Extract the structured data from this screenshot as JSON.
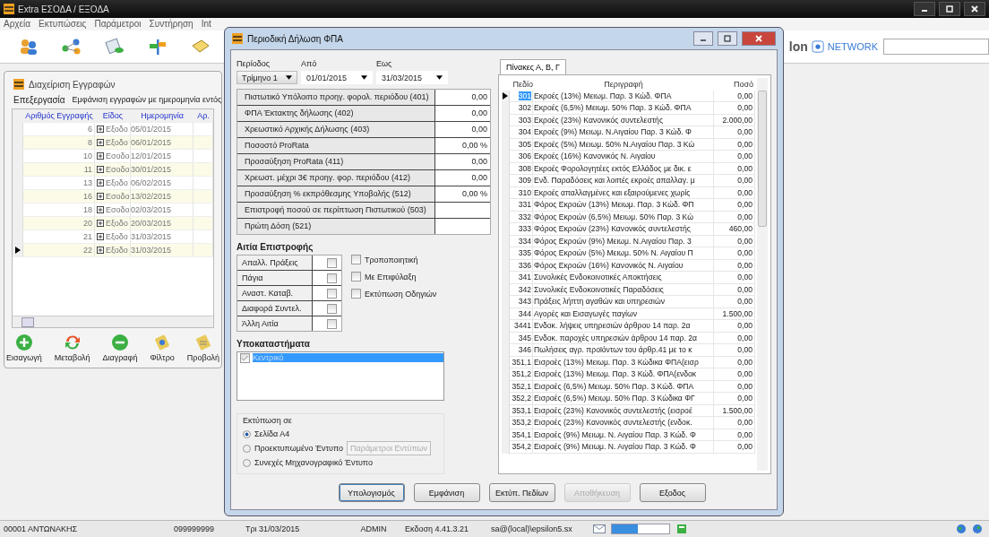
{
  "app": {
    "title": "Extra ΕΣΟΔΑ / ΕΞΟΔΑ",
    "menu": [
      "Αρχεία",
      "Εκτυπώσεις",
      "Παράμετροι",
      "Συντήρηση",
      "Int"
    ],
    "brand": {
      "partial": "lon",
      "network": "NETWORK"
    }
  },
  "documents_panel": {
    "title": "Διαχείριση Εγγραφών",
    "menu": [
      "Επεξεργασία",
      "Εμφάνιση εγγραφών με ημερομηνία εντός"
    ],
    "columns": [
      "Αριθμός Εγγραφής",
      "Είδος",
      "Ημερομηνία",
      "Αρ."
    ],
    "rows": [
      {
        "number": "6",
        "kind": "Εξοδο",
        "date": "05/01/2015",
        "selected": false
      },
      {
        "number": "8",
        "kind": "Εξοδο",
        "date": "06/01/2015",
        "selected": false
      },
      {
        "number": "10",
        "kind": "Εσοδο",
        "date": "12/01/2015",
        "selected": false
      },
      {
        "number": "11",
        "kind": "Εσοδο",
        "date": "30/01/2015",
        "selected": false
      },
      {
        "number": "13",
        "kind": "Εξοδο",
        "date": "06/02/2015",
        "selected": false
      },
      {
        "number": "16",
        "kind": "Εσοδο",
        "date": "13/02/2015",
        "selected": false
      },
      {
        "number": "18",
        "kind": "Εσοδο",
        "date": "02/03/2015",
        "selected": false
      },
      {
        "number": "20",
        "kind": "Εξοδο",
        "date": "20/03/2015",
        "selected": false
      },
      {
        "number": "21",
        "kind": "Εξοδο",
        "date": "31/03/2015",
        "selected": false
      },
      {
        "number": "22",
        "kind": "Εξοδο",
        "date": "31/03/2015",
        "selected": true
      }
    ],
    "actions": [
      {
        "label": "Εισαγωγή",
        "kind": "add"
      },
      {
        "label": "Μεταβολή",
        "kind": "modify"
      },
      {
        "label": "Διαγραφή",
        "kind": "delete"
      },
      {
        "label": "Φίλτρο",
        "kind": "filter"
      },
      {
        "label": "Προβολή",
        "kind": "view"
      }
    ]
  },
  "dialog": {
    "title": "Περιοδική Δήλωση ΦΠΑ",
    "period": {
      "label": "Περίοδος",
      "value": "Τρίμηνο 1"
    },
    "from": {
      "label": "Από",
      "value": "01/01/2015"
    },
    "to": {
      "label": "Εως",
      "value": "31/03/2015"
    },
    "fields": [
      {
        "label": "Πιστωτικό Υπόλοιπο προηγ. φορολ. περιόδου (401)",
        "value": "0,00"
      },
      {
        "label": "ΦΠΑ Έκτακτης δήλωσης (402)",
        "value": "0,00"
      },
      {
        "label": "Χρεωστικό Αρχικής Δήλωσης (403)",
        "value": "0,00"
      },
      {
        "label": "Ποσοστό ProRata",
        "value": "0,00 %"
      },
      {
        "label": "Προσαύξηση ProRata (411)",
        "value": "0,00"
      },
      {
        "label": "Χρεωστ. μέχρι 3€ προηγ. φορ. περιόδου (412)",
        "value": "0,00"
      },
      {
        "label": "Προσαύξηση % εκπρόθεσμης Υποβολής (512)",
        "value": "0,00 %"
      },
      {
        "label": "Επιστροφή ποσού σε περίπτωση Πιστωτικού (503)"
      },
      {
        "label": "Πρώτη Δόση (521)"
      }
    ],
    "refund_reason": {
      "title": "Αιτία Επιστροφής",
      "items": [
        {
          "label": "Απαλλ. Πράξεις",
          "checked": false
        },
        {
          "label": "Πάγια",
          "checked": false
        },
        {
          "label": "Αναστ. Καταβ.",
          "checked": false
        },
        {
          "label": "Διαφορά Συντελ.",
          "checked": false
        },
        {
          "label": "Άλλη Αιτία",
          "checked": false
        }
      ]
    },
    "options": [
      {
        "label": "Τροποποιητική",
        "checked": false
      },
      {
        "label": "Με Επιφύλαξη",
        "checked": false
      },
      {
        "label": "Εκτύπωση Οδηγιών",
        "checked": false
      }
    ],
    "branches": {
      "title": "Υποκαταστήματα",
      "items": [
        {
          "label": "Κεντρικό",
          "checked": true,
          "selected": true
        }
      ]
    },
    "print": {
      "title": "Εκτύπωση σε",
      "options": [
        {
          "label": "Σελίδα Α4",
          "selected": true
        },
        {
          "label": "Προεκτυπωμένο Έντυπο",
          "selected": false
        },
        {
          "label": "Συνεχές Μηχανογραφικό Έντυπο",
          "selected": false
        }
      ],
      "params_button": "Παράμετροι Εντύπων"
    },
    "tab": "Πίνακες Α, Β, Γ",
    "table": {
      "columns": [
        "Πεδίο",
        "Περιγραφή",
        "Ποσό"
      ],
      "rows": [
        {
          "field": "301",
          "description": "Εκροές (13%)  Μειωμ. Παρ. 3 Κώδ. ΦΠΑ",
          "amount": "0,00",
          "selected": true
        },
        {
          "field": "302",
          "description": "Εκροές (6,5%) Μειωμ. 50% Παρ. 3 Κώδ. ΦΠΑ",
          "amount": "0,00",
          "selected": false
        },
        {
          "field": "303",
          "description": "Εκροές (23%) Κανονικός συντελεστής",
          "amount": "2.000,00",
          "selected": false
        },
        {
          "field": "304",
          "description": "Εκροές (9%)  Μειωμ. Ν.Αιγαίου Παρ. 3 Κώδ. Φ",
          "amount": "0,00",
          "selected": false
        },
        {
          "field": "305",
          "description": "Εκροές (5%) Μειωμ. 50% Ν.Αιγαίου Παρ. 3 Κώ",
          "amount": "0,00",
          "selected": false
        },
        {
          "field": "306",
          "description": "Εκροές (16%) Κανονικός Ν. Αιγαίου",
          "amount": "0,00",
          "selected": false
        },
        {
          "field": "308",
          "description": "Εκροές Φορολογητέες εκτός Ελλάδος με δικ. ε",
          "amount": "0,00",
          "selected": false
        },
        {
          "field": "309",
          "description": "Ενδ. Παραδόσεις και λοιπές εκροές απαλλαγ. μ",
          "amount": "0,00",
          "selected": false
        },
        {
          "field": "310",
          "description": "Εκροές απαλλαγμένες και εξαιρούμενες χωρίς",
          "amount": "0,00",
          "selected": false
        },
        {
          "field": "331",
          "description": "Φόρος Εκροών (13%)  Μειωμ. Παρ. 3 Κώδ. ΦΠ",
          "amount": "0,00",
          "selected": false
        },
        {
          "field": "332",
          "description": "Φόρος Εκροών (6,5%) Μειωμ. 50% Παρ. 3 Κώ",
          "amount": "0,00",
          "selected": false
        },
        {
          "field": "333",
          "description": "Φόρος Εκροών (23%) Κανονικός συντελεστής",
          "amount": "460,00",
          "selected": false
        },
        {
          "field": "334",
          "description": "Φόρος Εκροών (9%)  Μειωμ. Ν.Αιγαίου Παρ. 3",
          "amount": "0,00",
          "selected": false
        },
        {
          "field": "335",
          "description": "Φόρος Εκροών (5%) Μειωμ. 50% Ν. Αιγαίου Π",
          "amount": "0,00",
          "selected": false
        },
        {
          "field": "336",
          "description": "Φόρος Εκροών (16%) Κανονικός Ν. Αιγαίου",
          "amount": "0,00",
          "selected": false
        },
        {
          "field": "341",
          "description": "Συνολικές Ενδοκοινοτικές Αποκτήσεις",
          "amount": "0,00",
          "selected": false
        },
        {
          "field": "342",
          "description": "Συνολικές Ενδοκοινοτικές Παραδόσεις",
          "amount": "0,00",
          "selected": false
        },
        {
          "field": "343",
          "description": "Πράξεις λήπτη αγαθών και υπηρεσιών",
          "amount": "0,00",
          "selected": false
        },
        {
          "field": "344",
          "description": "Αγορές και Εισαγωγές παγίων",
          "amount": "1.500,00",
          "selected": false
        },
        {
          "field": "3441",
          "description": "Ενδοκ. λήψεις υπηρεσιών άρθρου 14 παρ. 2α",
          "amount": "0,00",
          "selected": false
        },
        {
          "field": "345",
          "description": "Ενδοκ. παροχές υπηρεσιών άρθρου 14 παρ. 2α",
          "amount": "0,00",
          "selected": false
        },
        {
          "field": "346",
          "description": "Πωλήσεις αγρ. προϊόντων του άρθρ.41 με το κ",
          "amount": "0,00",
          "selected": false
        },
        {
          "field": "351,1",
          "description": "Εισροές (13%) Μειωμ. Παρ. 3 Κώδικα ΦΠΑ(εισρ",
          "amount": "0,00",
          "selected": false
        },
        {
          "field": "351,2",
          "description": "Εισροές (13%) Μειωμ. Παρ. 3 Κώδ. ΦΠΑ(ενδοκ",
          "amount": "0,00",
          "selected": false
        },
        {
          "field": "352,1",
          "description": "Εισροές (6,5%) Μειωμ. 50% Παρ. 3 Κώδ. ΦΠΑ",
          "amount": "0,00",
          "selected": false
        },
        {
          "field": "352,2",
          "description": "Εισροές (6,5%) Μειωμ. 50% Παρ. 3 Κώδικα ΦΓ",
          "amount": "0,00",
          "selected": false
        },
        {
          "field": "353,1",
          "description": "Εισροές (23%) Κανονικός συντελεστής (εισροέ",
          "amount": "1.500,00",
          "selected": false
        },
        {
          "field": "353,2",
          "description": "Εισροές (23%) Κανονικός συντελεστής (ενδοκ.",
          "amount": "0,00",
          "selected": false
        },
        {
          "field": "354,1",
          "description": "Εισροές (9%) Μειωμ. Ν. Αιγαίου Παρ. 3 Κώδ. Φ",
          "amount": "0,00",
          "selected": false
        },
        {
          "field": "354,2",
          "description": "Εισροές (9%) Μειωμ. Ν. Αιγαίου Παρ. 3 Κώδ. Φ",
          "amount": "0,00",
          "selected": false
        }
      ]
    },
    "buttons": [
      {
        "label": "Υπολογισμός",
        "disabled": false,
        "selected": true
      },
      {
        "label": "Εμφάνιση",
        "disabled": false,
        "selected": false
      },
      {
        "label": "Εκτύπ. Πεδίων",
        "disabled": false,
        "selected": false
      },
      {
        "label": "Αποθήκευση",
        "disabled": true,
        "selected": false
      },
      {
        "label": "Εξοδος",
        "disabled": false,
        "selected": false
      }
    ]
  },
  "status_bar": {
    "user": "00001 ΑΝΤΩΝΑΚΗΣ",
    "code": "099999999",
    "date": "Τρι 31/03/2015",
    "login": "ADMIN",
    "version": "Εκδοση 4.41.3.21",
    "database": "sa@(local)\\epsilon5.sx",
    "progress": {
      "level": 0.45
    }
  }
}
